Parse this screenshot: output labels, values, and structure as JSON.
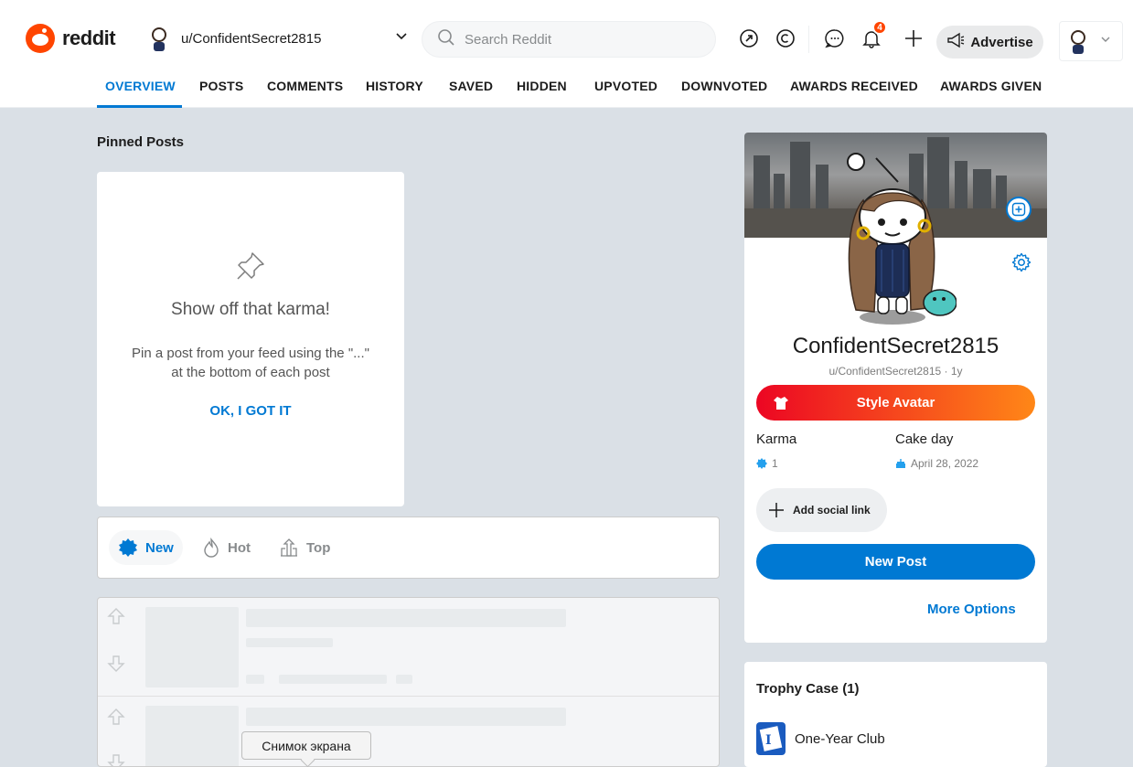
{
  "header": {
    "logo_text": "reddit",
    "username": "u/ConfidentSecret2815",
    "search_placeholder": "Search Reddit",
    "notification_count": "4",
    "advertise_label": "Advertise"
  },
  "tabs": [
    {
      "label": "OVERVIEW",
      "active": true
    },
    {
      "label": "POSTS"
    },
    {
      "label": "COMMENTS"
    },
    {
      "label": "HISTORY"
    },
    {
      "label": "SAVED"
    },
    {
      "label": "HIDDEN"
    },
    {
      "label": "UPVOTED"
    },
    {
      "label": "DOWNVOTED"
    },
    {
      "label": "AWARDS RECEIVED"
    },
    {
      "label": "AWARDS GIVEN"
    }
  ],
  "pinned": {
    "title": "Pinned Posts",
    "headline": "Show off that karma!",
    "description": "Pin a post from your feed using the \"...\" at the bottom of each post",
    "action": "OK, I GOT IT"
  },
  "sort": {
    "new": "New",
    "hot": "Hot",
    "top": "Top"
  },
  "profile": {
    "display_name": "ConfidentSecret2815",
    "subtitle": "u/ConfidentSecret2815 · 1y",
    "style_avatar": "Style Avatar",
    "karma_label": "Karma",
    "karma_value": "1",
    "cakeday_label": "Cake day",
    "cakeday_value": "April 28, 2022",
    "add_social": "Add social link",
    "new_post": "New Post",
    "more_options": "More Options"
  },
  "trophy": {
    "title": "Trophy Case (1)",
    "item": "One-Year Club"
  },
  "tooltip": "Снимок экрана",
  "colors": {
    "accent": "#0079d3",
    "brand": "#ff4500",
    "page_bg": "#dae0e6"
  }
}
